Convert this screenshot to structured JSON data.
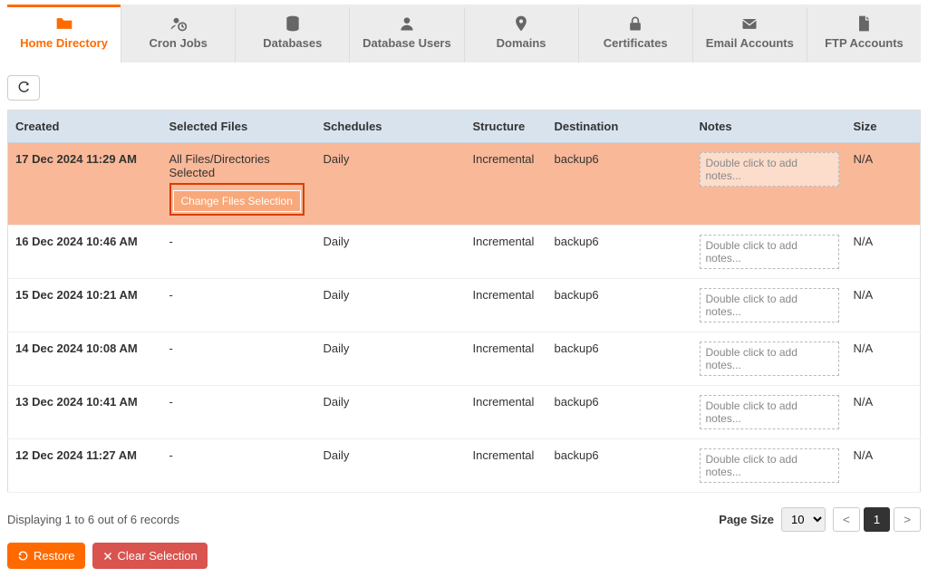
{
  "tabs": [
    {
      "label": "Home Directory",
      "icon": "folder",
      "active": true
    },
    {
      "label": "Cron Jobs",
      "icon": "user-clock"
    },
    {
      "label": "Databases",
      "icon": "database"
    },
    {
      "label": "Database Users",
      "icon": "user"
    },
    {
      "label": "Domains",
      "icon": "map-pin"
    },
    {
      "label": "Certificates",
      "icon": "lock"
    },
    {
      "label": "Email Accounts",
      "icon": "envelope"
    },
    {
      "label": "FTP Accounts",
      "icon": "file"
    }
  ],
  "table": {
    "headers": {
      "created": "Created",
      "selected_files": "Selected Files",
      "schedules": "Schedules",
      "structure": "Structure",
      "destination": "Destination",
      "notes": "Notes",
      "size": "Size"
    },
    "rows": [
      {
        "created": "17 Dec 2024 11:29 AM",
        "files_text": "All Files/Directories Selected",
        "change_btn": "Change Files Selection",
        "schedules": "Daily",
        "structure": "Incremental",
        "destination": "backup6",
        "notes_placeholder": "Double click to add notes...",
        "size": "N/A",
        "selected": true
      },
      {
        "created": "16 Dec 2024 10:46 AM",
        "files_text": "-",
        "schedules": "Daily",
        "structure": "Incremental",
        "destination": "backup6",
        "notes_placeholder": "Double click to add notes...",
        "size": "N/A"
      },
      {
        "created": "15 Dec 2024 10:21 AM",
        "files_text": "-",
        "schedules": "Daily",
        "structure": "Incremental",
        "destination": "backup6",
        "notes_placeholder": "Double click to add notes...",
        "size": "N/A"
      },
      {
        "created": "14 Dec 2024 10:08 AM",
        "files_text": "-",
        "schedules": "Daily",
        "structure": "Incremental",
        "destination": "backup6",
        "notes_placeholder": "Double click to add notes...",
        "size": "N/A"
      },
      {
        "created": "13 Dec 2024 10:41 AM",
        "files_text": "-",
        "schedules": "Daily",
        "structure": "Incremental",
        "destination": "backup6",
        "notes_placeholder": "Double click to add notes...",
        "size": "N/A"
      },
      {
        "created": "12 Dec 2024 11:27 AM",
        "files_text": "-",
        "schedules": "Daily",
        "structure": "Incremental",
        "destination": "backup6",
        "notes_placeholder": "Double click to add notes...",
        "size": "N/A"
      }
    ]
  },
  "footer": {
    "display_text": "Displaying 1 to 6 out of 6 records",
    "page_size_label": "Page Size",
    "page_size_value": "10",
    "prev": "<",
    "page": "1",
    "next": ">"
  },
  "actions": {
    "restore": "Restore",
    "clear": "Clear Selection"
  }
}
